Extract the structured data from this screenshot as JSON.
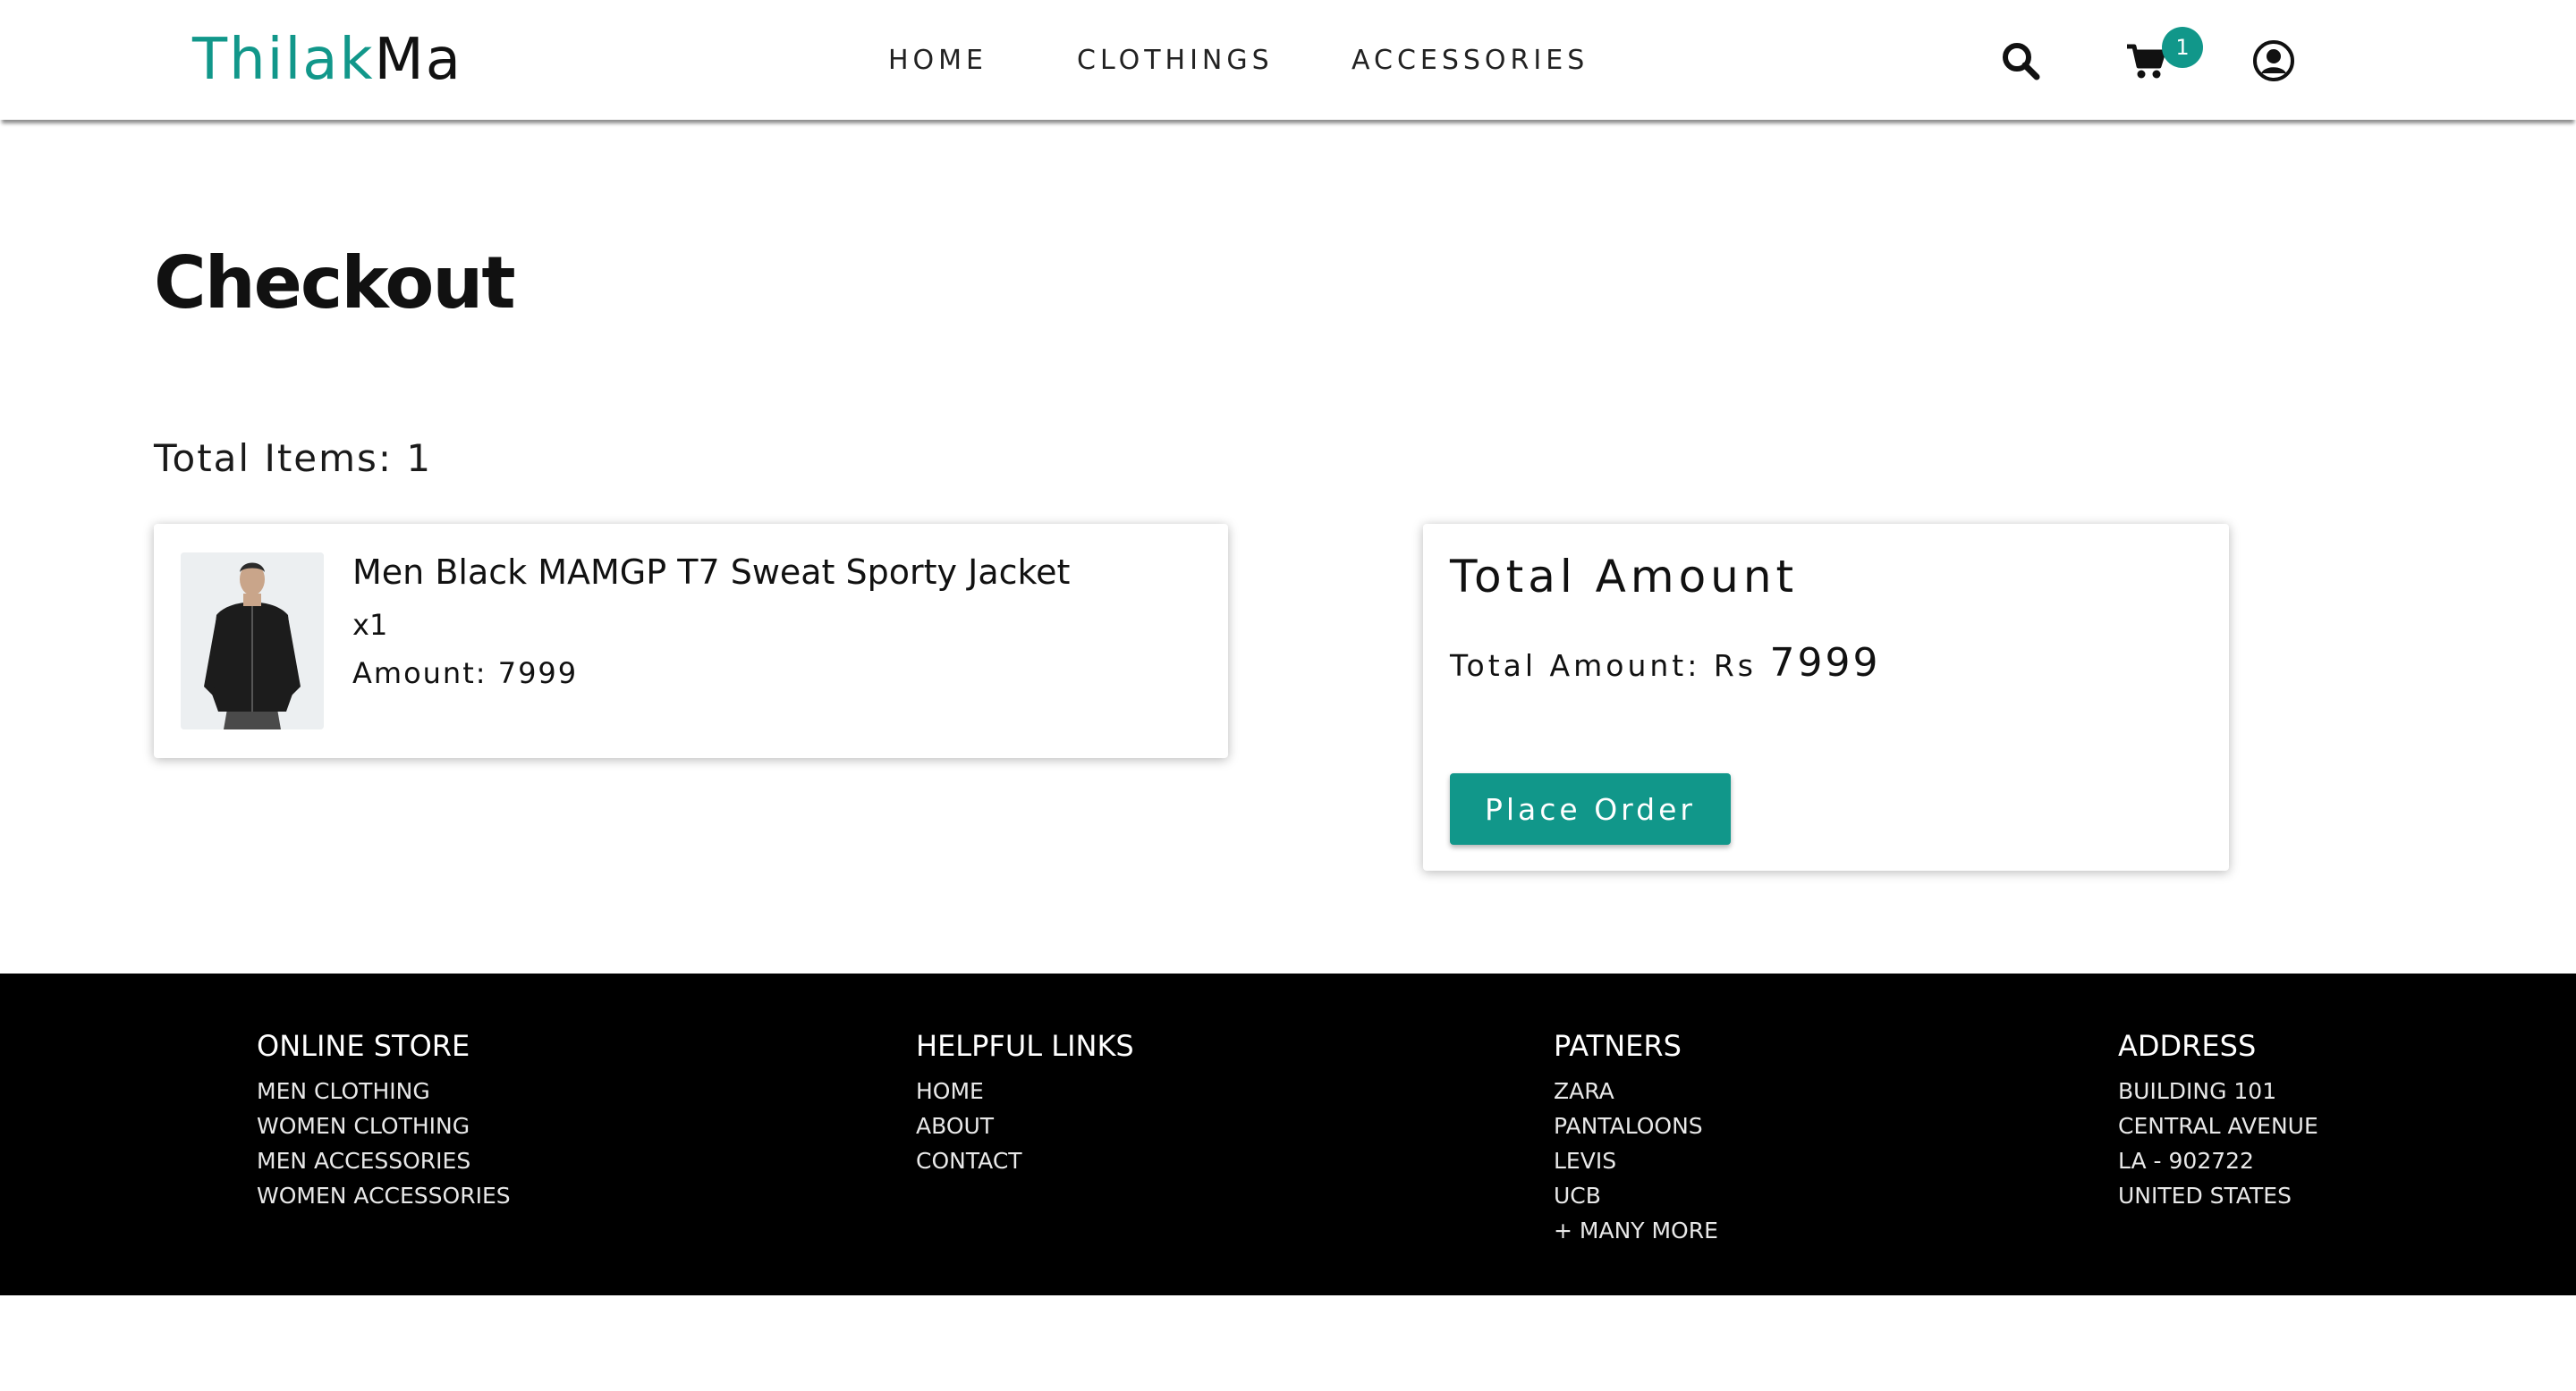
{
  "header": {
    "logo_part1": "Thilak",
    "logo_part2": "Ma",
    "nav": [
      "HOME",
      "CLOTHINGS",
      "ACCESSORIES"
    ],
    "cart_count": "1",
    "icons": [
      "search-icon",
      "cart-icon",
      "user-icon"
    ]
  },
  "main": {
    "title": "Checkout",
    "total_items_label": "Total Items: 1",
    "items": [
      {
        "name": "Men Black MAMGP T7 Sweat Sporty Jacket",
        "qty": "x1",
        "amount": "Amount: 7999"
      }
    ],
    "summary": {
      "heading": "Total Amount",
      "label": "Total Amount: Rs ",
      "value": "7999",
      "button": "Place Order"
    }
  },
  "footer": {
    "columns": [
      {
        "title": "ONLINE STORE",
        "links": [
          "MEN CLOTHING",
          "WOMEN CLOTHING",
          "MEN ACCESSORIES",
          "WOMEN ACCESSORIES"
        ]
      },
      {
        "title": "HELPFUL LINKS",
        "links": [
          "HOME",
          "ABOUT",
          "CONTACT"
        ]
      },
      {
        "title": "PATNERS",
        "links": [
          "ZARA",
          "PANTALOONS",
          "LEVIS",
          "UCB",
          "+ MANY MORE"
        ]
      },
      {
        "title": "ADDRESS",
        "links": [
          "BUILDING 101",
          "CENTRAL AVENUE",
          "LA - 902722",
          "UNITED STATES"
        ]
      }
    ]
  },
  "colors": {
    "accent": "#11978a",
    "footer_bg": "#000000"
  }
}
